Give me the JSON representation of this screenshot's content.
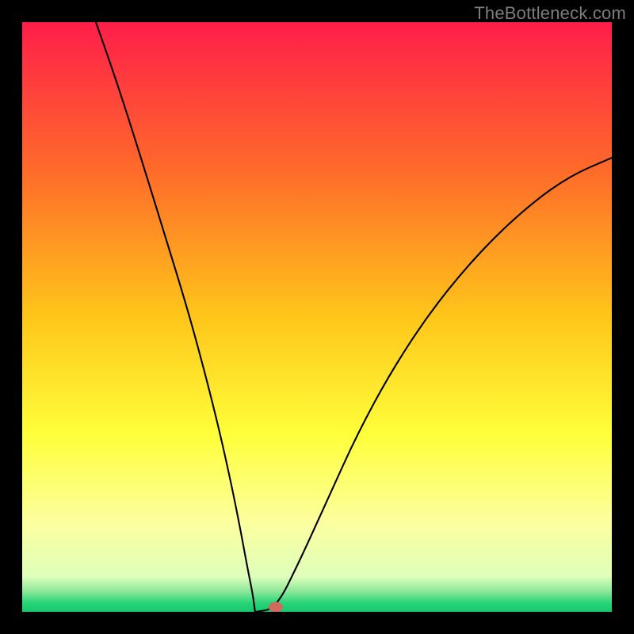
{
  "watermark": {
    "text": "TheBottleneck.com"
  },
  "chart_data": {
    "type": "line",
    "title": "",
    "xlabel": "",
    "ylabel": "",
    "xlim": [
      0,
      1
    ],
    "ylim": [
      0,
      1
    ],
    "background": {
      "stops": [
        {
          "offset": 0.0,
          "color": "#ff1e4a"
        },
        {
          "offset": 0.25,
          "color": "#ff6a2a"
        },
        {
          "offset": 0.5,
          "color": "#ffc61a"
        },
        {
          "offset": 0.7,
          "color": "#ffff3a"
        },
        {
          "offset": 0.85,
          "color": "#fcffa0"
        },
        {
          "offset": 0.94,
          "color": "#dfffba"
        },
        {
          "offset": 0.965,
          "color": "#8de89a"
        },
        {
          "offset": 0.985,
          "color": "#28d478"
        },
        {
          "offset": 1.0,
          "color": "#16c86d"
        }
      ]
    },
    "curve": {
      "min_x": 0.395,
      "left_start": {
        "x": 0.125,
        "y": 1.0
      },
      "right_end": {
        "x": 1.0,
        "y": 0.77
      },
      "samples_left": [
        {
          "x": 0.125,
          "y": 1.0
        },
        {
          "x": 0.16,
          "y": 0.9
        },
        {
          "x": 0.2,
          "y": 0.775
        },
        {
          "x": 0.24,
          "y": 0.645
        },
        {
          "x": 0.28,
          "y": 0.515
        },
        {
          "x": 0.31,
          "y": 0.405
        },
        {
          "x": 0.335,
          "y": 0.305
        },
        {
          "x": 0.355,
          "y": 0.215
        },
        {
          "x": 0.37,
          "y": 0.14
        },
        {
          "x": 0.382,
          "y": 0.075
        },
        {
          "x": 0.391,
          "y": 0.03
        },
        {
          "x": 0.395,
          "y": 0.0
        }
      ],
      "samples_right": [
        {
          "x": 0.395,
          "y": 0.0
        },
        {
          "x": 0.43,
          "y": 0.005
        },
        {
          "x": 0.47,
          "y": 0.085
        },
        {
          "x": 0.52,
          "y": 0.195
        },
        {
          "x": 0.57,
          "y": 0.305
        },
        {
          "x": 0.63,
          "y": 0.415
        },
        {
          "x": 0.7,
          "y": 0.52
        },
        {
          "x": 0.78,
          "y": 0.615
        },
        {
          "x": 0.86,
          "y": 0.69
        },
        {
          "x": 0.93,
          "y": 0.74
        },
        {
          "x": 1.0,
          "y": 0.77
        }
      ]
    },
    "marker": {
      "x": 0.43,
      "y": 0.008,
      "color": "#d06a5f"
    }
  },
  "colors": {
    "frame": "#000000",
    "curve": "#000000",
    "watermark": "#7c7c7c"
  }
}
